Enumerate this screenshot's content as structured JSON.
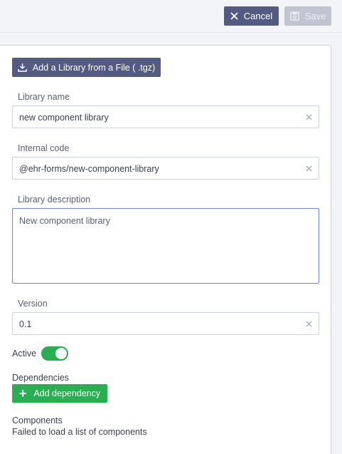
{
  "toolbar": {
    "cancel_label": "Cancel",
    "save_label": "Save"
  },
  "form": {
    "import_button_label": "Add a Library from a File ( .tgz)",
    "library_name": {
      "label": "Library name",
      "value": "new component library"
    },
    "internal_code": {
      "label": "Internal code",
      "value": "@ehr-forms/new-component-library"
    },
    "library_description": {
      "label": "Library description",
      "value": "New component library"
    },
    "version": {
      "label": "Version",
      "value": "0.1"
    },
    "active": {
      "label": "Active",
      "on": true
    },
    "dependencies": {
      "label": "Dependencies",
      "add_button_label": "Add dependency"
    },
    "components": {
      "label": "Components",
      "error_text": "Failed to load a list of components"
    }
  },
  "colors": {
    "primary": "#535b82",
    "success": "#2aae52",
    "disabled": "#c1c5d2",
    "focus_border": "#6f86d6"
  }
}
